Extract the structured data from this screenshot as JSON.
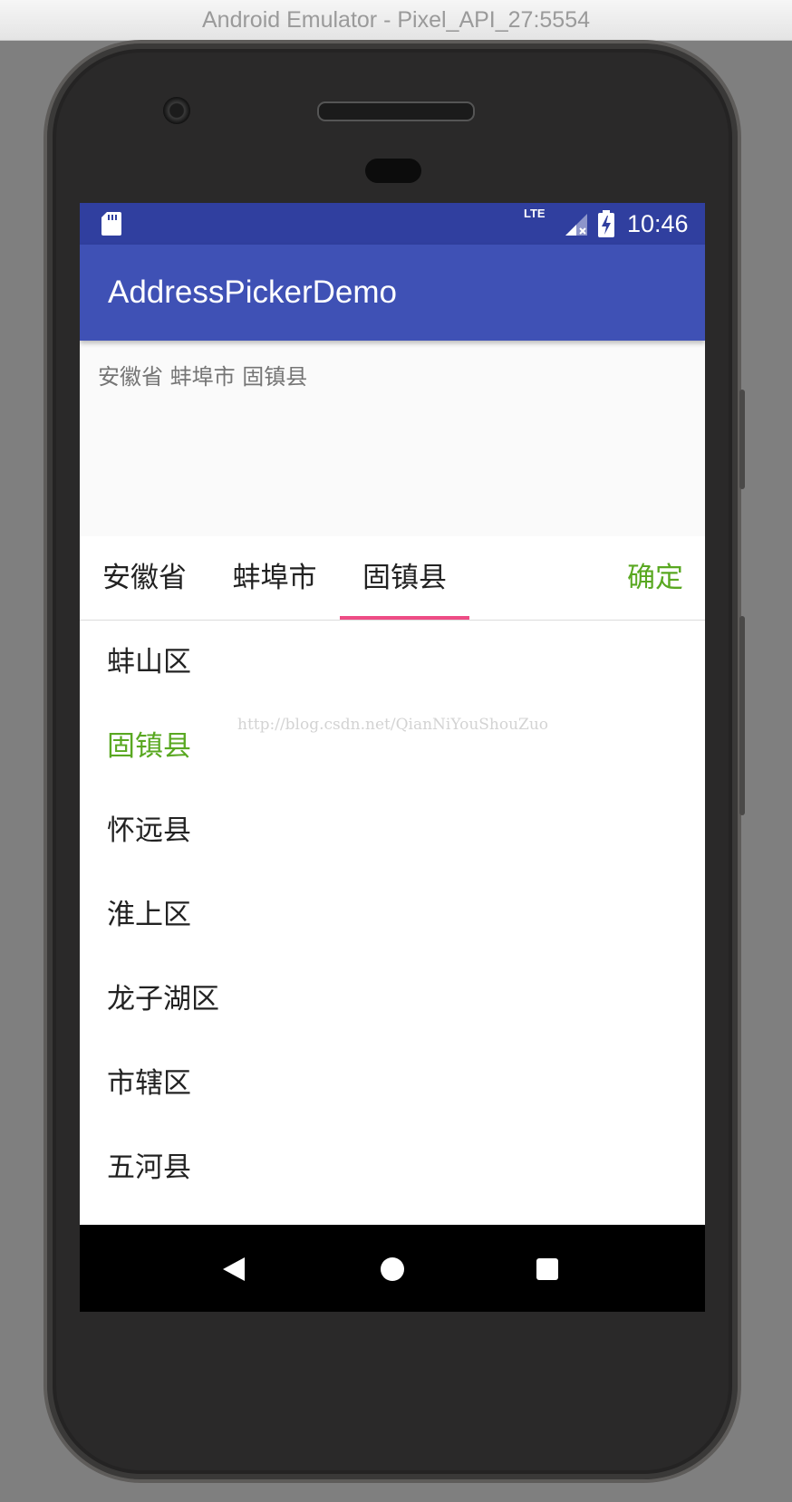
{
  "window": {
    "title": "Android Emulator - Pixel_API_27:5554"
  },
  "statusbar": {
    "time": "10:46",
    "network": "LTE"
  },
  "app": {
    "title": "AddressPickerDemo"
  },
  "selected_address": "安徽省 蚌埠市 固镇县",
  "picker": {
    "tabs": [
      {
        "label": "安徽省"
      },
      {
        "label": "蚌埠市"
      },
      {
        "label": "固镇县"
      }
    ],
    "active_tab": 2,
    "confirm_label": "确定",
    "items": [
      {
        "label": "蚌山区"
      },
      {
        "label": "固镇县"
      },
      {
        "label": "怀远县"
      },
      {
        "label": "淮上区"
      },
      {
        "label": "龙子湖区"
      },
      {
        "label": "市辖区"
      },
      {
        "label": "五河县"
      }
    ],
    "selected_item": 1
  },
  "watermark": "http://blog.csdn.net/QianNiYouShouZuo",
  "colors": {
    "status_bar": "#303f9f",
    "app_bar": "#3f51b5",
    "accent_green": "#59a821",
    "tab_indicator": "#ee4c85"
  }
}
